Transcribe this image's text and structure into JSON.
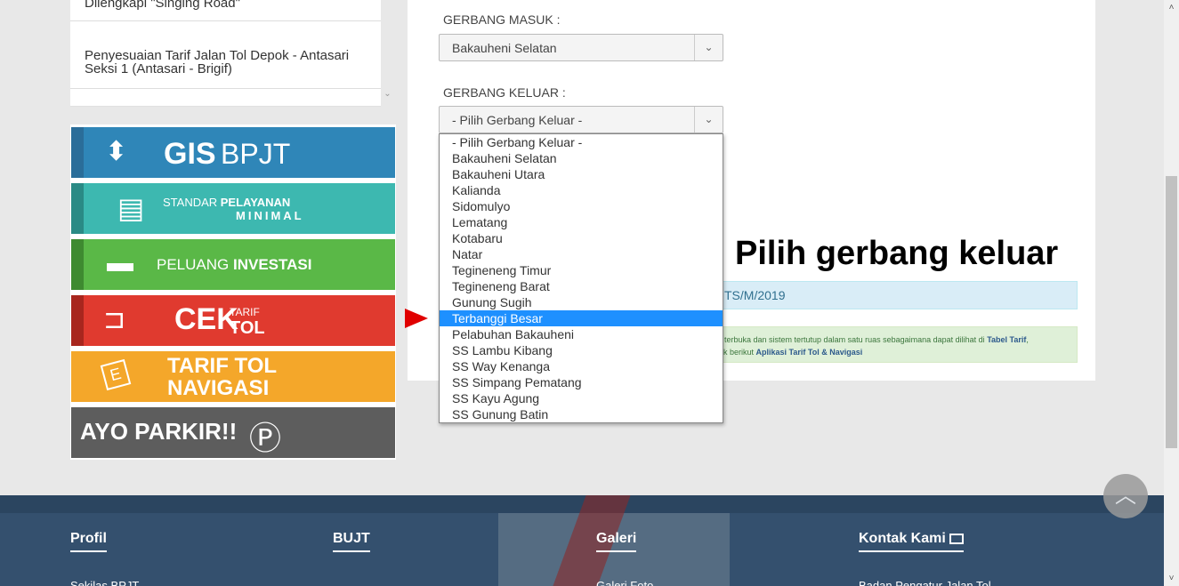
{
  "news": {
    "item1": "Dilengkapi \"Singing Road\"",
    "item2": "Penyesuaian Tarif Jalan Tol Depok - Antasari Seksi 1 (Antasari - Brigif)"
  },
  "banners": {
    "gis_bold": "GIS",
    "gis_light": "BPJT",
    "spm_line1_a": "STANDAR ",
    "spm_line1_b": "PELAYANAN",
    "spm_line2": "MINIMAL",
    "inv_a": "PELUANG ",
    "inv_b": "INVESTASI",
    "cek_big": "CEK",
    "cek_small1": "TARIF",
    "cek_small2": "TOL",
    "nav1": "TARIF TOL",
    "nav2": "NAVIGASI",
    "park": "AYO PARKIR!!"
  },
  "form": {
    "entry_label": "GERBANG MASUK :",
    "entry_value": "Bakauheni Selatan",
    "exit_label": "GERBANG KELUAR :",
    "exit_value": "- Pilih Gerbang Keluar -"
  },
  "dropdown_options": [
    "- Pilih Gerbang Keluar -",
    "Bakauheni Selatan",
    "Bakauheni Utara",
    "Kalianda",
    "Sidomulyo",
    "Lematang",
    "Kotabaru",
    "Natar",
    "Tegineneng Timur",
    "Tegineneng Barat",
    "Gunung Sugih",
    "Terbanggi Besar",
    "Pelabuhan Bakauheni",
    "SS Lambu Kibang",
    "SS Way Kenanga",
    "SS Simpang Pematang",
    "SS Kayu Agung",
    "SS Gunung Batin"
  ],
  "highlighted_option": "Terbanggi Besar",
  "info": {
    "text": "TS/M/2019"
  },
  "note": {
    "text1": "m terbuka dan sistem tertutup dalam satu ruas sebagaimana dapat dilihat di ",
    "link1": "Tabel Tarif",
    "text1_end": ",",
    "text2": "link berikut ",
    "link2": "Aplikasi Tarif Tol & Navigasi"
  },
  "annotation": "Pilih gerbang keluar",
  "footer": {
    "profil": "Profil",
    "profil_sub": "Sekilas BPJT",
    "bujt": "BUJT",
    "galeri": "Galeri",
    "galeri_sub": "Galeri Foto",
    "kontak": "Kontak Kami",
    "kontak_sub": "Badan Pengatur Jalan Tol"
  },
  "colors": {
    "highlight": "#1e90ff",
    "arrow": "#e00000",
    "footer": "#34506e"
  }
}
